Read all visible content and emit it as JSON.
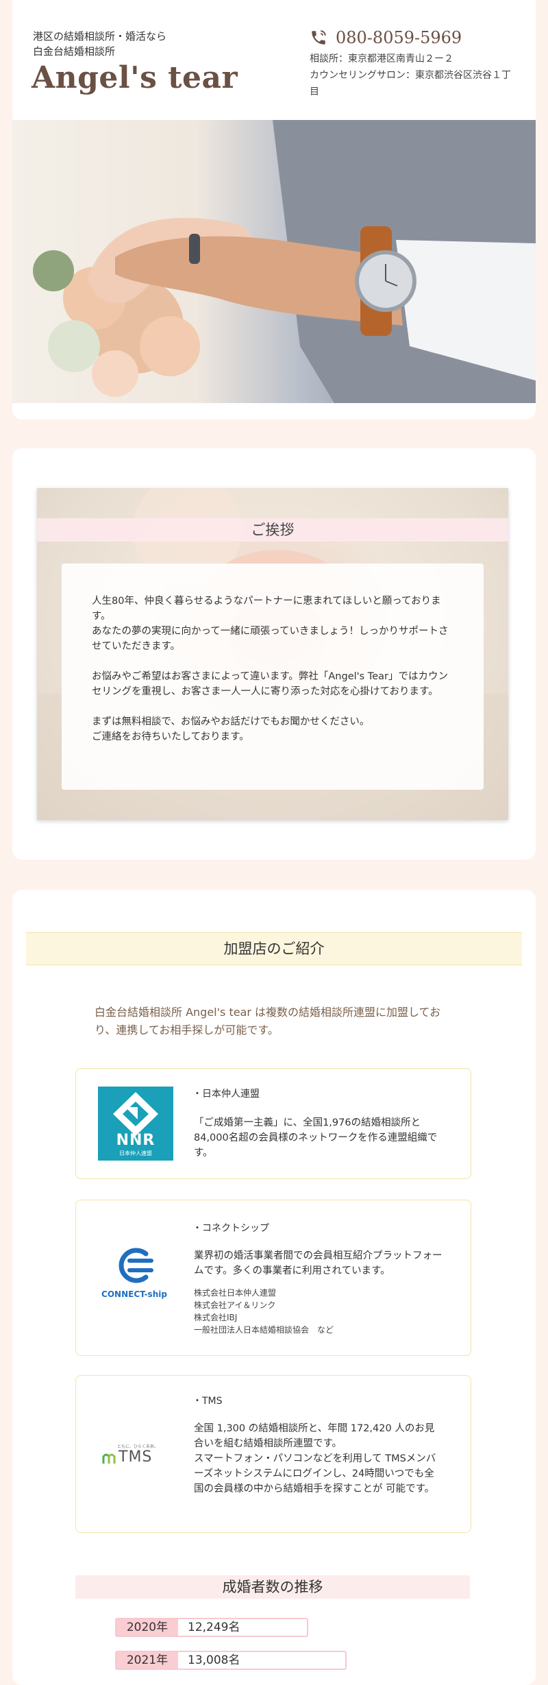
{
  "header": {
    "tagline_1": "港区の結婚相談所・婚活なら",
    "tagline_2": "白金台結婚相談所",
    "logo": "Angel's tear",
    "phone": "080-8059-5969",
    "address_1": "相談所：東京都港区南青山２ー２",
    "address_2": "カウンセリングサロン：東京都渋谷区渋谷１丁目"
  },
  "greeting": {
    "title": "ご挨拶",
    "paragraphs": [
      "人生80年、仲良く暮らせるようなパートナーに恵まれてほしいと願っております。\nあなたの夢の実現に向かって一緒に頑張っていきましょう！しっかりサポートさせていただきます。",
      "お悩みやご希望はお客さまによって違います。弊社「Angel's Tear」ではカウンセリングを重視し、お客さま一人一人に寄り添った対応を心掛けております。",
      "まずは無料相談で、お悩みやお話だけでもお聞かせください。\nご連絡をお待ちいたしております。"
    ]
  },
  "members": {
    "title": "加盟店のご紹介",
    "intro": "白金台結婚相談所 Angel's tear は複数の結婚相談所連盟に加盟しており、連携してお相手探しが可能です。",
    "orgs": [
      {
        "name": "・日本仲人連盟",
        "logo_text": "NNR",
        "logo_sub": "日本仲人連盟",
        "desc": "「ご成婚第一主義」に、全国1,976の結婚相談所と84,000名超の会員様のネットワークを作る連盟組織です。"
      },
      {
        "name": "・コネクトシップ",
        "logo_text": "CONNECT-ship",
        "desc": "業界初の婚活事業者間での会員相互紹介プラットフォームです。多くの事業者に利用されています。",
        "members": [
          "株式会社日本仲人連盟",
          "株式会社アイ＆リンク",
          "株式会社IBJ",
          "一般社団法人日本結婚相談協会　など"
        ]
      },
      {
        "name": "・TMS",
        "logo_text": "TMS",
        "logo_sub": "ともに、ひらく未来。",
        "desc": "全国 1,300 の結婚相談所と、年間 172,420 人のお見合いを組む結婚相談所連盟です。\nスマートフォン・パソコンなどを利用して TMSメンバーズネットシステムにログインし、24時間いつでも全国の会員様の中から結婚相手を探すことが 可能です。"
      }
    ]
  },
  "marriages": {
    "title": "成婚者数の推移",
    "rows": [
      {
        "year": "2020年",
        "value": "12,249名"
      },
      {
        "year": "2021年",
        "value": "13,008名"
      }
    ]
  },
  "colors": {
    "brand_brown": "#6b5044",
    "nnr_teal": "#1aa0b8",
    "connect_blue": "#1f6fc0",
    "tms_green": "#4caf50"
  }
}
